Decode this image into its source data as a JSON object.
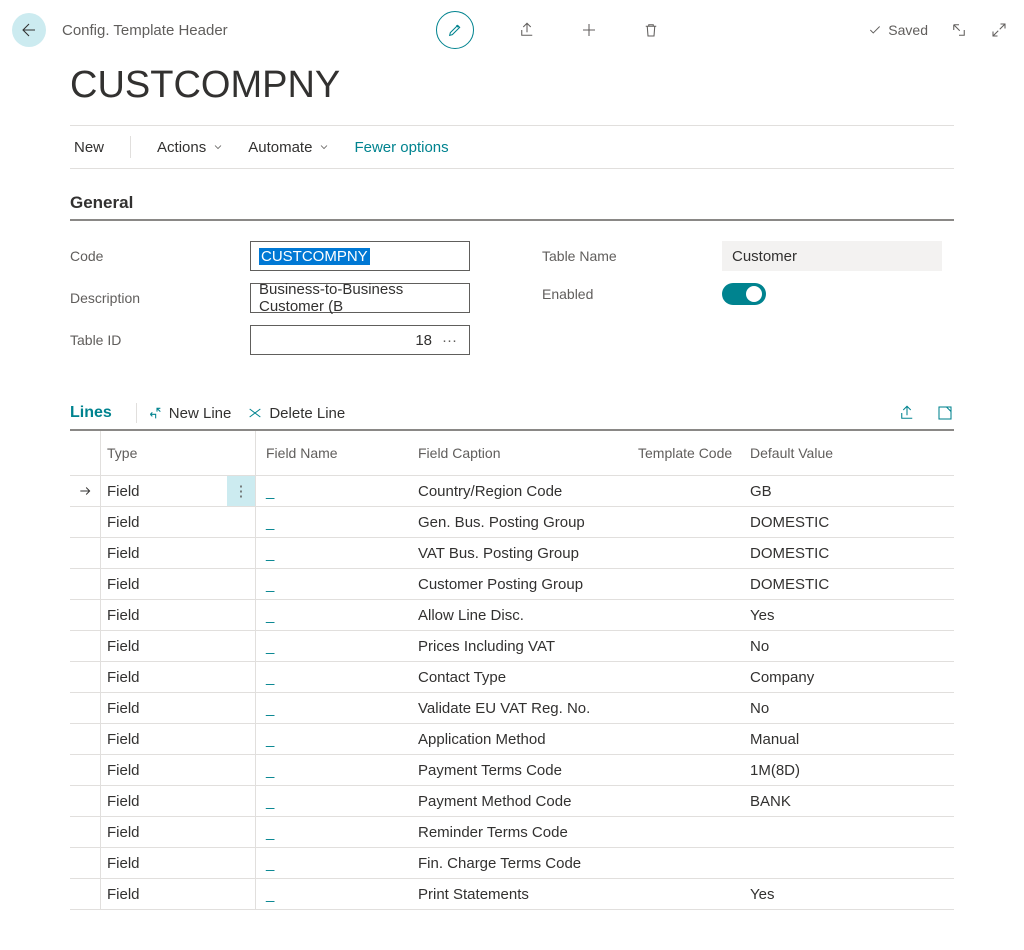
{
  "header": {
    "breadcrumb": "Config. Template Header",
    "saved_label": "Saved"
  },
  "title": "CUSTCOMPNY",
  "commands": {
    "new_label": "New",
    "actions_label": "Actions",
    "automate_label": "Automate",
    "fewer_options_label": "Fewer options"
  },
  "general": {
    "section_title": "General",
    "code_label": "Code",
    "code_value": "CUSTCOMPNY",
    "description_label": "Description",
    "description_value": "Business-to-Business Customer (B",
    "table_id_label": "Table ID",
    "table_id_value": "18",
    "lookup_symbol": "···",
    "table_name_label": "Table Name",
    "table_name_value": "Customer",
    "enabled_label": "Enabled",
    "enabled_value": true
  },
  "lines": {
    "section_title": "Lines",
    "new_line_label": "New Line",
    "delete_line_label": "Delete Line",
    "columns": {
      "type": "Type",
      "field_name": "Field Name",
      "field_caption": "Field Caption",
      "template_code": "Template Code",
      "default_value": "Default Value"
    },
    "dash": "_",
    "rows": [
      {
        "type": "Field",
        "field_name": "",
        "field_caption": "Country/Region Code",
        "template_code": "",
        "default_value": "GB",
        "selected": true
      },
      {
        "type": "Field",
        "field_name": "",
        "field_caption": "Gen. Bus. Posting Group",
        "template_code": "",
        "default_value": "DOMESTIC"
      },
      {
        "type": "Field",
        "field_name": "",
        "field_caption": "VAT Bus. Posting Group",
        "template_code": "",
        "default_value": "DOMESTIC"
      },
      {
        "type": "Field",
        "field_name": "",
        "field_caption": "Customer Posting Group",
        "template_code": "",
        "default_value": "DOMESTIC"
      },
      {
        "type": "Field",
        "field_name": "",
        "field_caption": "Allow Line Disc.",
        "template_code": "",
        "default_value": "Yes"
      },
      {
        "type": "Field",
        "field_name": "",
        "field_caption": "Prices Including VAT",
        "template_code": "",
        "default_value": "No"
      },
      {
        "type": "Field",
        "field_name": "",
        "field_caption": "Contact Type",
        "template_code": "",
        "default_value": "Company"
      },
      {
        "type": "Field",
        "field_name": "",
        "field_caption": "Validate EU VAT Reg. No.",
        "template_code": "",
        "default_value": "No"
      },
      {
        "type": "Field",
        "field_name": "",
        "field_caption": "Application Method",
        "template_code": "",
        "default_value": "Manual"
      },
      {
        "type": "Field",
        "field_name": "",
        "field_caption": "Payment Terms Code",
        "template_code": "",
        "default_value": "1M(8D)"
      },
      {
        "type": "Field",
        "field_name": "",
        "field_caption": "Payment Method Code",
        "template_code": "",
        "default_value": "BANK"
      },
      {
        "type": "Field",
        "field_name": "",
        "field_caption": "Reminder Terms Code",
        "template_code": "",
        "default_value": ""
      },
      {
        "type": "Field",
        "field_name": "",
        "field_caption": "Fin. Charge Terms Code",
        "template_code": "",
        "default_value": ""
      },
      {
        "type": "Field",
        "field_name": "",
        "field_caption": "Print Statements",
        "template_code": "",
        "default_value": "Yes"
      }
    ]
  }
}
